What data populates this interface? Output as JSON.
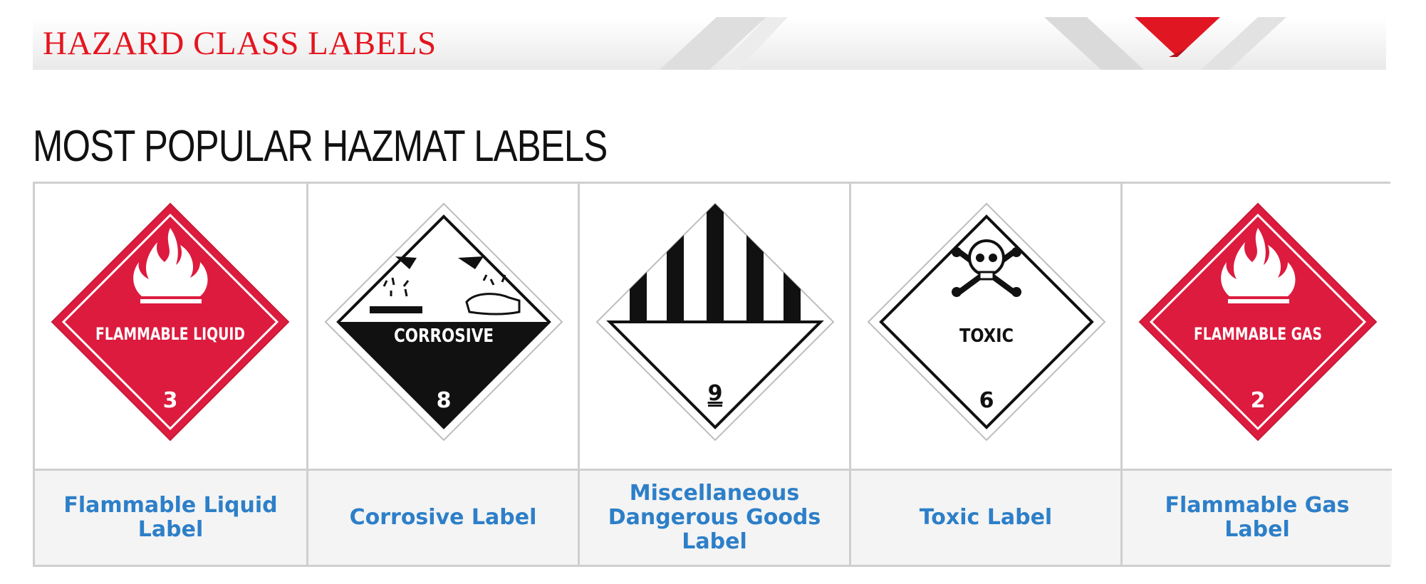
{
  "banner": {
    "title": "HAZARD CLASS LABELS",
    "accent_color": "#e4151f"
  },
  "section": {
    "title": "MOST POPULAR HAZMAT LABELS"
  },
  "products": [
    {
      "caption": "Flammable Liquid Label",
      "label_text": "FLAMMABLE LIQUID",
      "class_number": "3",
      "icon": "flame-icon",
      "bg_color": "#dc1b3e"
    },
    {
      "caption": "Corrosive Label",
      "label_text": "CORROSIVE",
      "class_number": "8",
      "icon": "corrosive-icon",
      "bg_color": "#ffffff"
    },
    {
      "caption": "Miscellaneous Dangerous Goods Label",
      "label_text": "",
      "class_number": "9",
      "icon": "stripes-icon",
      "bg_color": "#ffffff"
    },
    {
      "caption": "Toxic Label",
      "label_text": "TOXIC",
      "class_number": "6",
      "icon": "skull-crossbones-icon",
      "bg_color": "#ffffff"
    },
    {
      "caption": "Flammable Gas Label",
      "label_text": "FLAMMABLE GAS",
      "class_number": "2",
      "icon": "flame-icon",
      "bg_color": "#dc1b3e"
    }
  ],
  "colors": {
    "caption_link": "#2d7fc8",
    "border": "#cfcfcf"
  }
}
